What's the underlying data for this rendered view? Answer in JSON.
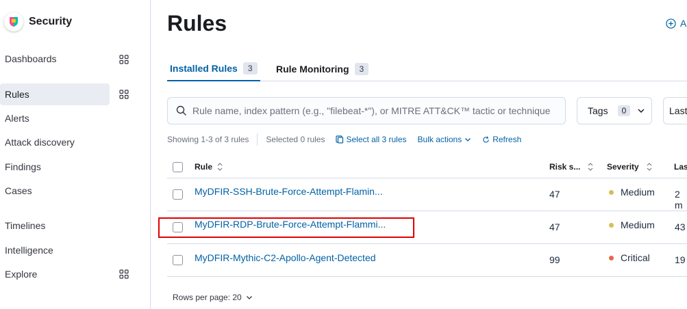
{
  "sidebar": {
    "title": "Security",
    "items": [
      {
        "label": "Dashboards"
      },
      {
        "label": "Rules"
      },
      {
        "label": "Alerts"
      },
      {
        "label": "Attack discovery"
      },
      {
        "label": "Findings"
      },
      {
        "label": "Cases"
      },
      {
        "label": "Timelines"
      },
      {
        "label": "Intelligence"
      },
      {
        "label": "Explore"
      }
    ],
    "active_item": "Rules"
  },
  "header": {
    "title": "Rules",
    "add_label": "A"
  },
  "tabs": [
    {
      "label": "Installed Rules",
      "count": "3",
      "active": true
    },
    {
      "label": "Rule Monitoring",
      "count": "3",
      "active": false
    }
  ],
  "search": {
    "placeholder": "Rule name, index pattern (e.g., \"filebeat-*\"), or MITRE ATT&CK™ tactic or technique"
  },
  "filters": {
    "tags_label": "Tags",
    "tags_count": "0",
    "last_label": "Last"
  },
  "utility": {
    "showing": "Showing 1-3 of 3 rules",
    "selected": "Selected 0 rules",
    "select_all": "Select all 3 rules",
    "bulk_actions": "Bulk actions",
    "refresh": "Refresh"
  },
  "table": {
    "columns": [
      "Rule",
      "Risk s...",
      "Severity",
      "Las"
    ],
    "rows": [
      {
        "rule": "MyDFIR-SSH-Brute-Force-Attempt-Flamin...",
        "risk": "47",
        "severity": "Medium",
        "last": "2 m"
      },
      {
        "rule": "MyDFIR-RDP-Brute-Force-Attempt-Flammi...",
        "risk": "47",
        "severity": "Medium",
        "last": "43"
      },
      {
        "rule": "MyDFIR-Mythic-C2-Apollo-Agent-Detected",
        "risk": "99",
        "severity": "Critical",
        "last": "19"
      }
    ]
  },
  "pagination": {
    "rows_per_page": "Rows per page: 20"
  },
  "colors": {
    "accent": "#0061a6",
    "medium": "#d6bf57",
    "critical": "#e7664c",
    "highlight": "#e00000"
  }
}
